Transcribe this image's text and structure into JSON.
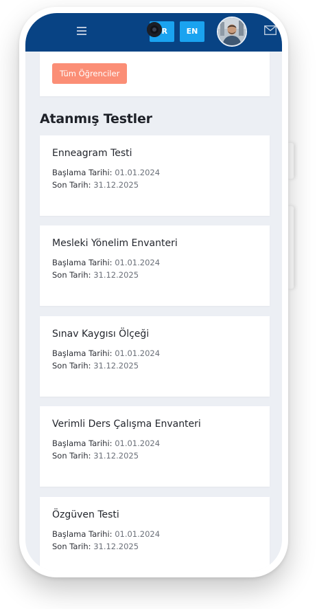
{
  "header": {
    "languages": [
      {
        "code": "TR",
        "label": "TR"
      },
      {
        "code": "EN",
        "label": "EN"
      }
    ],
    "icons": {
      "menu": "hamburger-menu-icon",
      "mail": "mail-icon",
      "avatar": "user-avatar"
    },
    "colors": {
      "bar": "#084384",
      "lang_button": "#1aa3f0"
    }
  },
  "top_card": {
    "all_students_button": "Tüm Öğrenciler",
    "button_color": "#fb8e76"
  },
  "section_title": "Atanmış Testler",
  "tests": [
    {
      "title": "Enneagram Testi",
      "start_label": "Başlama Tarihi:",
      "start_date": "01.01.2024",
      "end_label": "Son Tarih:",
      "end_date": "31.12.2025"
    },
    {
      "title": "Mesleki Yönelim Envanteri",
      "start_label": "Başlama Tarihi:",
      "start_date": "01.01.2024",
      "end_label": "Son Tarih:",
      "end_date": "31.12.2025"
    },
    {
      "title": "Sınav Kaygısı Ölçeği",
      "start_label": "Başlama Tarihi:",
      "start_date": "01.01.2024",
      "end_label": "Son Tarih:",
      "end_date": "31.12.2025"
    },
    {
      "title": "Verimli Ders Çalışma Envanteri",
      "start_label": "Başlama Tarihi:",
      "start_date": "01.01.2024",
      "end_label": "Son Tarih:",
      "end_date": "31.12.2025"
    },
    {
      "title": "Özgüven Testi",
      "start_label": "Başlama Tarihi:",
      "start_date": "01.01.2024",
      "end_label": "Son Tarih:",
      "end_date": "31.12.2025"
    }
  ]
}
